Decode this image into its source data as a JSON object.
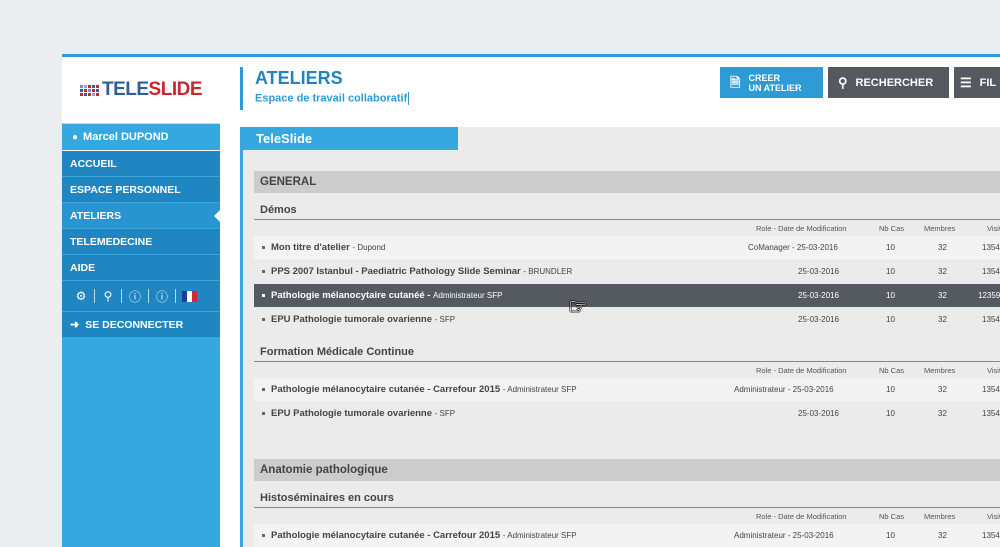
{
  "sidebar": {
    "logo": {
      "part1": "TELE",
      "part2": "SLIDE"
    },
    "user": {
      "name": "Marcel DUPOND",
      "icon": "user-icon"
    },
    "nav": [
      {
        "label": "ACCUEIL",
        "active": false
      },
      {
        "label": "ESPACE PERSONNEL",
        "active": false
      },
      {
        "label": "ATELIERS",
        "active": true
      },
      {
        "label": "TELEMEDECINE",
        "active": false
      },
      {
        "label": "AIDE",
        "active": false
      }
    ],
    "tools": [
      "settings-users-icon",
      "search-icon",
      "help-icon",
      "info-icon",
      "flag-fr-icon"
    ],
    "logout": "SE DECONNECTER"
  },
  "header": {
    "title": "ATELIERS",
    "subtitle": "Espace de travail collaboratif",
    "buttons": {
      "create_line1": "CREER",
      "create_line2": "UN ATELIER",
      "search": "RECHERCHER",
      "filter": "FIL"
    }
  },
  "panel": {
    "tab": "TeleSlide",
    "sections": [
      {
        "title": "GENERAL",
        "groups": [
          {
            "title": "Démos",
            "columns": [
              "Role - Date de Modification",
              "Nb Cas",
              "Membres",
              "Visit"
            ],
            "rows": [
              {
                "title": "Mon titre d'atelier",
                "by": "- Dupond",
                "role_date": "CoManager - 25-03-2016",
                "cases": "10",
                "members": "32",
                "visits": "1354"
              },
              {
                "title": "PPS 2007  Istanbul - Paediatric Pathology Slide Seminar",
                "by": "- BRUNDLER",
                "role_date": "25-03-2016",
                "cases": "10",
                "members": "32",
                "visits": "1354"
              },
              {
                "title": "Pathologie mélanocytaire cutanéé -",
                "by": "Administrateur SFP",
                "role_date": "25-03-2016",
                "cases": "10",
                "members": "32",
                "visits": "12359"
              },
              {
                "title": "EPU Pathologie tumorale ovarienne",
                "by": "- SFP",
                "role_date": "25-03-2016",
                "cases": "10",
                "members": "32",
                "visits": "1354"
              }
            ]
          },
          {
            "title": "Formation Médicale Continue",
            "columns": [
              "Role - Date de Modification",
              "Nb Cas",
              "Membres",
              "Visit"
            ],
            "rows": [
              {
                "title": "Pathologie mélanocytaire cutanée - Carrefour 2015",
                "by": "- Administrateur SFP",
                "role_date": "Administrateur - 25-03-2016",
                "cases": "10",
                "members": "32",
                "visits": "1354"
              },
              {
                "title": "EPU Pathologie tumorale ovarienne",
                "by": "- SFP",
                "role_date": "25-03-2016",
                "cases": "10",
                "members": "32",
                "visits": "1354"
              }
            ]
          }
        ]
      },
      {
        "title": "Anatomie pathologique",
        "groups": [
          {
            "title": "Histoséminaires en cours",
            "columns": [
              "Role - Date de Modification",
              "Nb Cas",
              "Membres",
              "Visit"
            ],
            "rows": [
              {
                "title": "Pathologie mélanocytaire cutanée - Carrefour 2015",
                "by": "- Administrateur SFP",
                "role_date": "Administrateur - 25-03-2016",
                "cases": "10",
                "members": "32",
                "visits": "1354"
              }
            ]
          }
        ]
      }
    ]
  },
  "colors": {
    "accent": "#35a8e0",
    "nav_dark": "#1f86c1",
    "button_dark": "#545a5f",
    "logo_blue": "#2f5e9a",
    "logo_red": "#c8262f"
  }
}
